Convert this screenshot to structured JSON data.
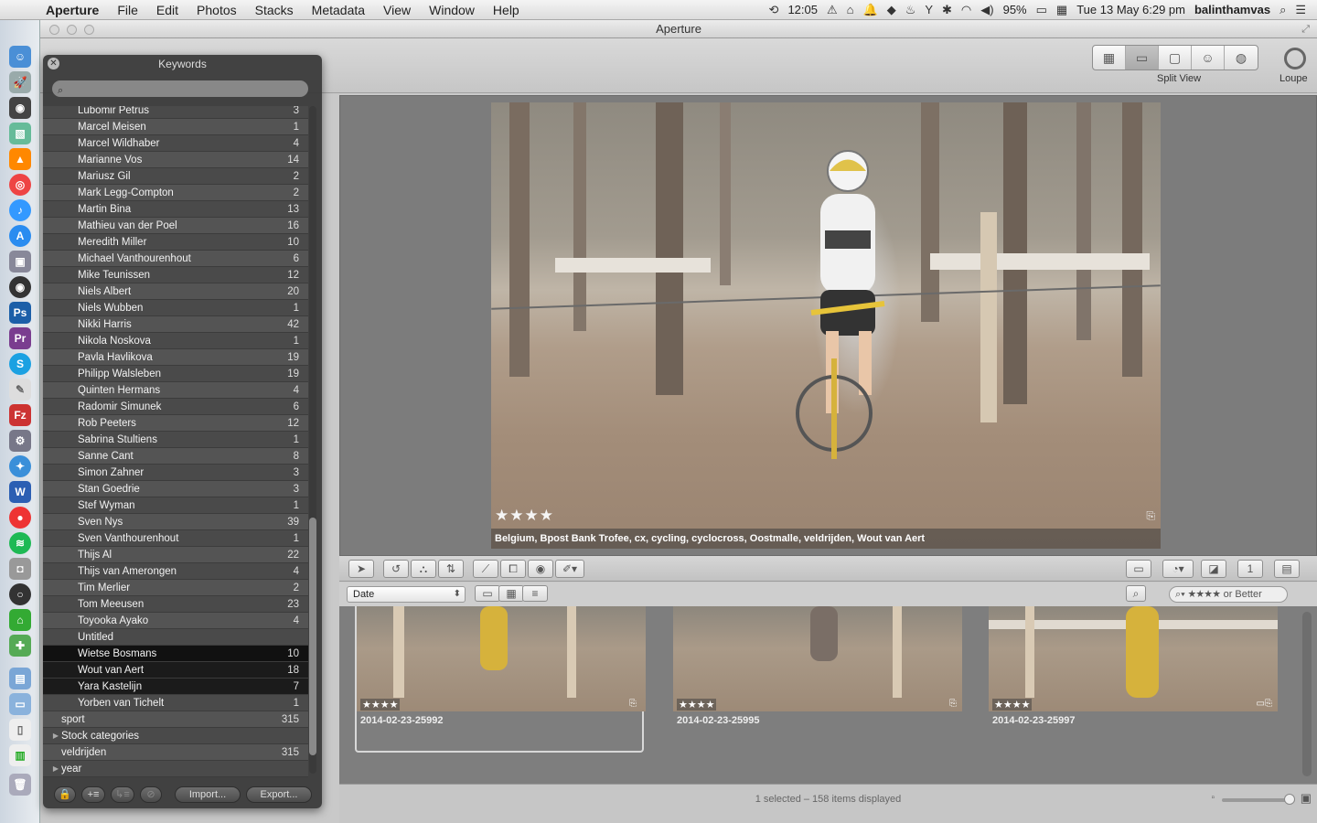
{
  "menubar": {
    "app_name": "Aperture",
    "items": [
      "File",
      "Edit",
      "Photos",
      "Stacks",
      "Metadata",
      "View",
      "Window",
      "Help"
    ],
    "clock_small": "12:05",
    "battery": "95%",
    "datetime": "Tue 13 May  6:29 pm",
    "user": "balinthamvas"
  },
  "window": {
    "title": "Aperture"
  },
  "toolbar": {
    "split_view_label": "Split View",
    "loupe_label": "Loupe"
  },
  "viewer": {
    "rating": "★★★★",
    "caption": "Belgium, Bpost Bank Trofee, cx, cycling, cyclocross, Oostmalle, veldrijden, Wout van Aert"
  },
  "browser": {
    "sort_value": "Date",
    "filter_text": "★★★★ or Better",
    "thumbnails": [
      {
        "name": "2014-02-23-25992",
        "rating": "★★★★"
      },
      {
        "name": "2014-02-23-25995",
        "rating": "★★★★"
      },
      {
        "name": "2014-02-23-25997",
        "rating": "★★★★"
      }
    ],
    "status": "1 selected – 158 items displayed"
  },
  "keywords_hud": {
    "title": "Keywords",
    "search_placeholder": "",
    "items": [
      {
        "label": "Lubomir Petrus",
        "count": "3"
      },
      {
        "label": "Marcel Meisen",
        "count": "1"
      },
      {
        "label": "Marcel Wildhaber",
        "count": "4"
      },
      {
        "label": "Marianne Vos",
        "count": "14"
      },
      {
        "label": "Mariusz Gil",
        "count": "2"
      },
      {
        "label": "Mark Legg-Compton",
        "count": "2"
      },
      {
        "label": "Martin Bina",
        "count": "13"
      },
      {
        "label": "Mathieu van der Poel",
        "count": "16"
      },
      {
        "label": "Meredith Miller",
        "count": "10"
      },
      {
        "label": "Michael Vanthourenhout",
        "count": "6"
      },
      {
        "label": "Mike Teunissen",
        "count": "12"
      },
      {
        "label": "Niels Albert",
        "count": "20"
      },
      {
        "label": "Niels Wubben",
        "count": "1"
      },
      {
        "label": "Nikki Harris",
        "count": "42"
      },
      {
        "label": "Nikola Noskova",
        "count": "1"
      },
      {
        "label": "Pavla Havlikova",
        "count": "19"
      },
      {
        "label": "Philipp Walsleben",
        "count": "19"
      },
      {
        "label": "Quinten Hermans",
        "count": "4"
      },
      {
        "label": "Radomir Simunek",
        "count": "6"
      },
      {
        "label": "Rob Peeters",
        "count": "12"
      },
      {
        "label": "Sabrina Stultiens",
        "count": "1"
      },
      {
        "label": "Sanne Cant",
        "count": "8"
      },
      {
        "label": "Simon Zahner",
        "count": "3"
      },
      {
        "label": "Stan Goedrie",
        "count": "3"
      },
      {
        "label": "Stef Wyman",
        "count": "1"
      },
      {
        "label": "Sven Nys",
        "count": "39"
      },
      {
        "label": "Sven Vanthourenhout",
        "count": "1"
      },
      {
        "label": "Thijs Al",
        "count": "22"
      },
      {
        "label": "Thijs van Amerongen",
        "count": "4"
      },
      {
        "label": "Tim Merlier",
        "count": "2"
      },
      {
        "label": "Tom Meeusen",
        "count": "23"
      },
      {
        "label": "Toyooka Ayako",
        "count": "4"
      },
      {
        "label": "Untitled",
        "count": ""
      },
      {
        "label": "Wietse Bosmans",
        "count": "10"
      },
      {
        "label": "Wout van Aert",
        "count": "18"
      },
      {
        "label": "Yara Kastelijn",
        "count": "7"
      },
      {
        "label": "Yorben van Tichelt",
        "count": "1"
      },
      {
        "label": "sport",
        "count": "315"
      },
      {
        "label": "Stock categories",
        "count": ""
      },
      {
        "label": "veldrijden",
        "count": "315"
      },
      {
        "label": "year",
        "count": ""
      }
    ],
    "import_label": "Import...",
    "export_label": "Export..."
  }
}
